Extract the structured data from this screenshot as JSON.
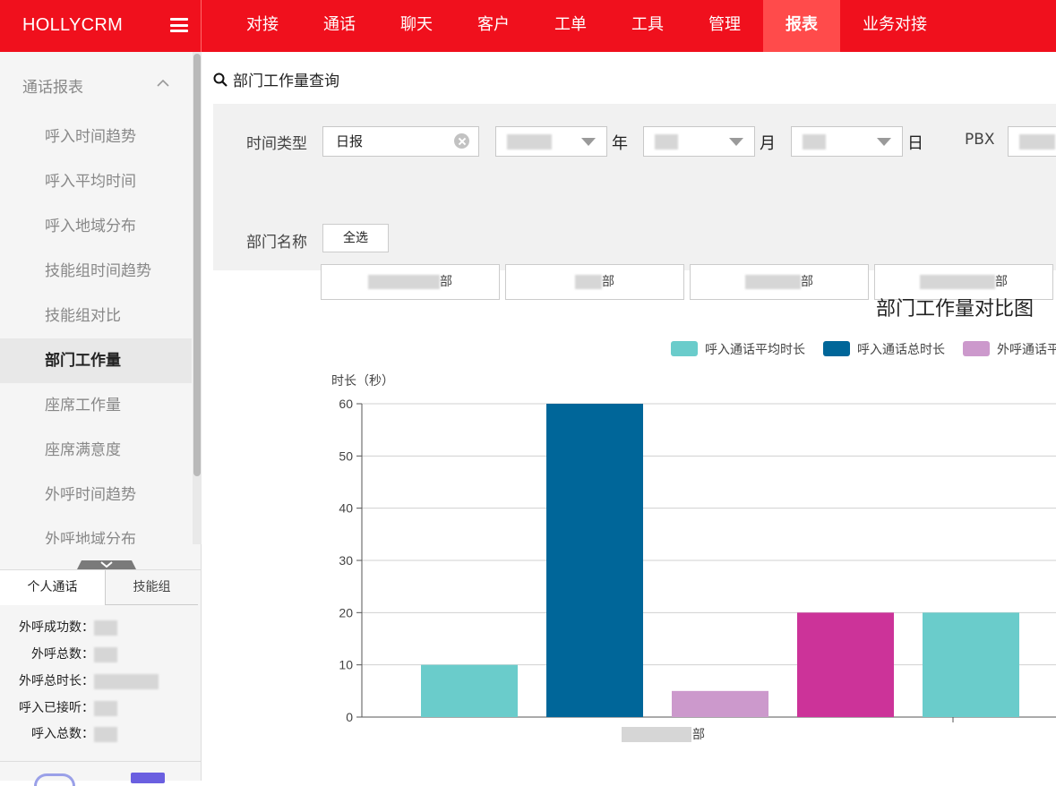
{
  "app": {
    "brand": "HOLLYCRM"
  },
  "nav": [
    {
      "label": "对接",
      "active": false
    },
    {
      "label": "通话",
      "active": false
    },
    {
      "label": "聊天",
      "active": false
    },
    {
      "label": "客户",
      "active": false
    },
    {
      "label": "工单",
      "active": false
    },
    {
      "label": "工具",
      "active": false
    },
    {
      "label": "管理",
      "active": false
    },
    {
      "label": "报表",
      "active": true
    },
    {
      "label": "业务对接",
      "active": false
    }
  ],
  "sidebar": {
    "section": "通话报表",
    "items": [
      {
        "label": "呼入时间趋势",
        "active": false
      },
      {
        "label": "呼入平均时间",
        "active": false
      },
      {
        "label": "呼入地域分布",
        "active": false
      },
      {
        "label": "技能组时间趋势",
        "active": false
      },
      {
        "label": "技能组对比",
        "active": false
      },
      {
        "label": "部门工作量",
        "active": true
      },
      {
        "label": "座席工作量",
        "active": false
      },
      {
        "label": "座席满意度",
        "active": false
      },
      {
        "label": "外呼时间趋势",
        "active": false
      },
      {
        "label": "外呼地域分布",
        "active": false
      }
    ],
    "stats_tabs": [
      "个人通话",
      "技能组"
    ],
    "stats": [
      {
        "label": "外呼成功数："
      },
      {
        "label": "外呼总数："
      },
      {
        "label": "外呼总时长："
      },
      {
        "label": "呼入已接听："
      },
      {
        "label": "呼入总数："
      }
    ]
  },
  "main": {
    "breadcrumb": "部门工作量查询",
    "filter": {
      "time_type_label": "时间类型",
      "time_type_value": "日报",
      "year_unit": "年",
      "month_unit": "月",
      "day_unit": "日",
      "pbx_label": "PBX",
      "dept_label": "部门名称",
      "select_all": "全选",
      "dept_suffix": "部"
    }
  },
  "chart_data": {
    "type": "bar",
    "title": "部门工作量对比图",
    "ylabel": "时长（秒）",
    "ylim": [
      0,
      60
    ],
    "yticks": [
      0,
      10,
      20,
      30,
      40,
      50,
      60
    ],
    "categories": [
      "部"
    ],
    "legend_position": "top-right",
    "grid": true,
    "series": [
      {
        "name": "呼入通话平均时长",
        "color": "#6acccb",
        "values": [
          10
        ]
      },
      {
        "name": "呼入通话总时长",
        "color": "#006699",
        "values": [
          60
        ]
      },
      {
        "name": "外呼通话平",
        "color": "#cc99cc",
        "values": [
          5
        ]
      },
      {
        "name": "",
        "color": "#cc3399",
        "values": [
          20
        ]
      },
      {
        "name": "",
        "color": "#6acccb",
        "values": [
          20
        ]
      }
    ]
  }
}
